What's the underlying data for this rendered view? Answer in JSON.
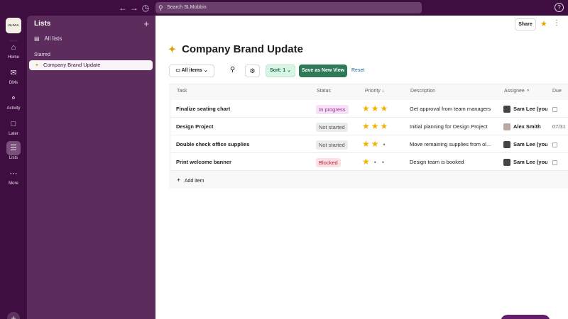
{
  "topbar": {
    "back_icon": "arrow-left-icon",
    "forward_icon": "arrow-right-icon",
    "history_icon": "clock-icon",
    "search_placeholder": "Search SLMobbin",
    "help_label": "?"
  },
  "workspace": {
    "logo_text": "OLIVIA GRAY"
  },
  "rail": {
    "items": [
      {
        "label": "Home",
        "icon": "home-icon"
      },
      {
        "label": "DMs",
        "icon": "dms-icon"
      },
      {
        "label": "Activity",
        "icon": "bell-icon"
      },
      {
        "label": "Later",
        "icon": "bookmark-icon"
      },
      {
        "label": "Lists",
        "icon": "lists-icon"
      },
      {
        "label": "More",
        "icon": "more-icon"
      }
    ]
  },
  "sidebar": {
    "title": "Lists",
    "all_lists": "All lists",
    "starred_heading": "Starred",
    "starred_item": "Company Brand Update"
  },
  "header": {
    "share_label": "Share"
  },
  "page": {
    "title": "Company Brand Update"
  },
  "toolbar": {
    "all_items": "All items",
    "sort": "Sort: 1",
    "save_view": "Save as New View",
    "reset": "Reset"
  },
  "table": {
    "columns": {
      "task": "Task",
      "status": "Status",
      "priority": "Priority",
      "description": "Description",
      "assignee": "Assignee",
      "due": "Due da"
    },
    "rows": [
      {
        "task": "Finalize seating chart",
        "status": "In progress",
        "priority": 3,
        "description": "Get approval from team managers",
        "assignee": "Sam Lee (you",
        "due": ""
      },
      {
        "task": "Design Project",
        "status": "Not started",
        "priority": 3,
        "description": "Initial planning for Design Project",
        "assignee": "Alex Smith",
        "due": "07/31"
      },
      {
        "task": "Double check office supplies",
        "status": "Not started",
        "priority": 2,
        "description": "Move remaining supplies from ol...",
        "assignee": "Sam Lee (you",
        "due": ""
      },
      {
        "task": "Print welcome banner",
        "status": "Blocked",
        "priority": 1,
        "description": "Design team is booked",
        "assignee": "Sam Lee (you",
        "due": ""
      }
    ],
    "add_item": "Add item"
  },
  "colors": {
    "aubergine": "#3f0e40",
    "sidebar": "#5b2c5c",
    "save_green": "#2f7a56",
    "star": "#f0b400"
  }
}
